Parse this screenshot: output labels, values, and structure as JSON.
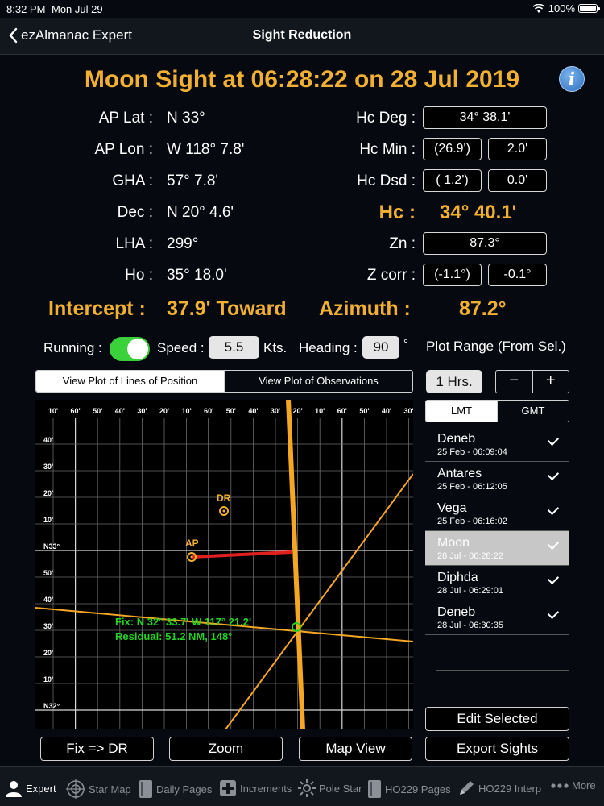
{
  "status": {
    "time": "8:32 PM",
    "date": "Mon Jul 29",
    "battery": "100%"
  },
  "nav": {
    "back_label": "ezAlmanac Expert",
    "title": "Sight Reduction"
  },
  "heading": "Moon Sight at 06:28:22 on 28 Jul 2019",
  "left": {
    "ap_lat_label": "AP Lat :",
    "ap_lat": "N 33°",
    "ap_lon_label": "AP Lon :",
    "ap_lon": "W 118°  7.8'",
    "gha_label": "GHA :",
    "gha": "57°  7.8'",
    "dec_label": "Dec :",
    "dec": "N 20°  4.6'",
    "lha_label": "LHA :",
    "lha": "299°",
    "ho_label": "Ho :",
    "ho": "35° 18.0'"
  },
  "right": {
    "hc_deg_label": "Hc Deg :",
    "hc_deg": "34° 38.1'",
    "hc_min_label": "Hc Min :",
    "hc_min_a": "(26.9')",
    "hc_min_b": "2.0'",
    "hc_dsd_label": "Hc Dsd :",
    "hc_dsd_a": "( 1.2')",
    "hc_dsd_b": "0.0'",
    "hc_label": "Hc :",
    "hc": "34° 40.1'",
    "zn_label": "Zn :",
    "zn": "87.3°",
    "zcorr_label": "Z corr :",
    "zcorr_a": "(-1.1°)",
    "zcorr_b": "-0.1°"
  },
  "result": {
    "intercept_label": "Intercept :",
    "intercept": "37.9' Toward",
    "azimuth_label": "Azimuth :",
    "azimuth": "87.2°"
  },
  "controls": {
    "running_label": "Running :",
    "running_on": true,
    "speed_label": "Speed :",
    "speed": "5.5",
    "speed_unit": "Kts.",
    "heading_label": "Heading :",
    "heading": "90",
    "heading_unit": "°",
    "plot_range_label": "Plot Range (From Sel.)",
    "hours": "1 Hrs.",
    "minus": "−",
    "plus": "+"
  },
  "view_tabs": [
    "View Plot of Lines of Position",
    "View Plot of Observations"
  ],
  "time_tabs": [
    "LMT",
    "GMT"
  ],
  "plot": {
    "top_ticks": [
      "10'",
      "60'",
      "50'",
      "40'",
      "30'",
      "20'",
      "10'",
      "60'",
      "50'",
      "40'",
      "30'",
      "20'",
      "10'",
      "60'",
      "50'",
      "40'",
      "30'"
    ],
    "left_ticks": [
      "40'",
      "30'",
      "20'",
      "10'",
      "N33°",
      "50'",
      "40'",
      "30'",
      "20'",
      "10'",
      "N32°"
    ],
    "dr_label": "DR",
    "ap_label": "AP",
    "fix_text": "Fix: N 32° 33.7' W 117° 21.2'",
    "residual_text": "Residual: 51.2 NM, 148°"
  },
  "sights": [
    {
      "name": "Deneb",
      "time": "25 Feb - 06:09:04",
      "selected": false
    },
    {
      "name": "Antares",
      "time": "25 Feb - 06:12:05",
      "selected": false
    },
    {
      "name": "Vega",
      "time": "25 Feb - 06:16:02",
      "selected": false
    },
    {
      "name": "Moon",
      "time": "28 Jul - 06:28:22",
      "selected": true
    },
    {
      "name": "Diphda",
      "time": "28 Jul - 06:29:01",
      "selected": false
    },
    {
      "name": "Deneb",
      "time": "28 Jul - 06:30:35",
      "selected": false
    }
  ],
  "buttons": {
    "fix_dr": "Fix => DR",
    "zoom": "Zoom",
    "map_view": "Map View",
    "edit_selected": "Edit Selected",
    "export_sights": "Export  Sights"
  },
  "tabbar": [
    {
      "label": "Expert",
      "icon": "person-icon"
    },
    {
      "label": "Star Map",
      "icon": "crosshair-icon"
    },
    {
      "label": "Daily Pages",
      "icon": "book-icon"
    },
    {
      "label": "Increments",
      "icon": "plus-square-icon"
    },
    {
      "label": "Pole Star",
      "icon": "sun-icon"
    },
    {
      "label": "HO229 Pages",
      "icon": "book-icon"
    },
    {
      "label": "HO229 Interp",
      "icon": "pencil-icon"
    },
    {
      "label": "More",
      "icon": "ellipsis-icon"
    }
  ],
  "colors": {
    "accent_gold": "#f2b033",
    "lop_orange": "#f5a623",
    "intercept_red": "#e0201e",
    "fix_green": "#22d322",
    "toggle_green": "#3ad13a"
  }
}
